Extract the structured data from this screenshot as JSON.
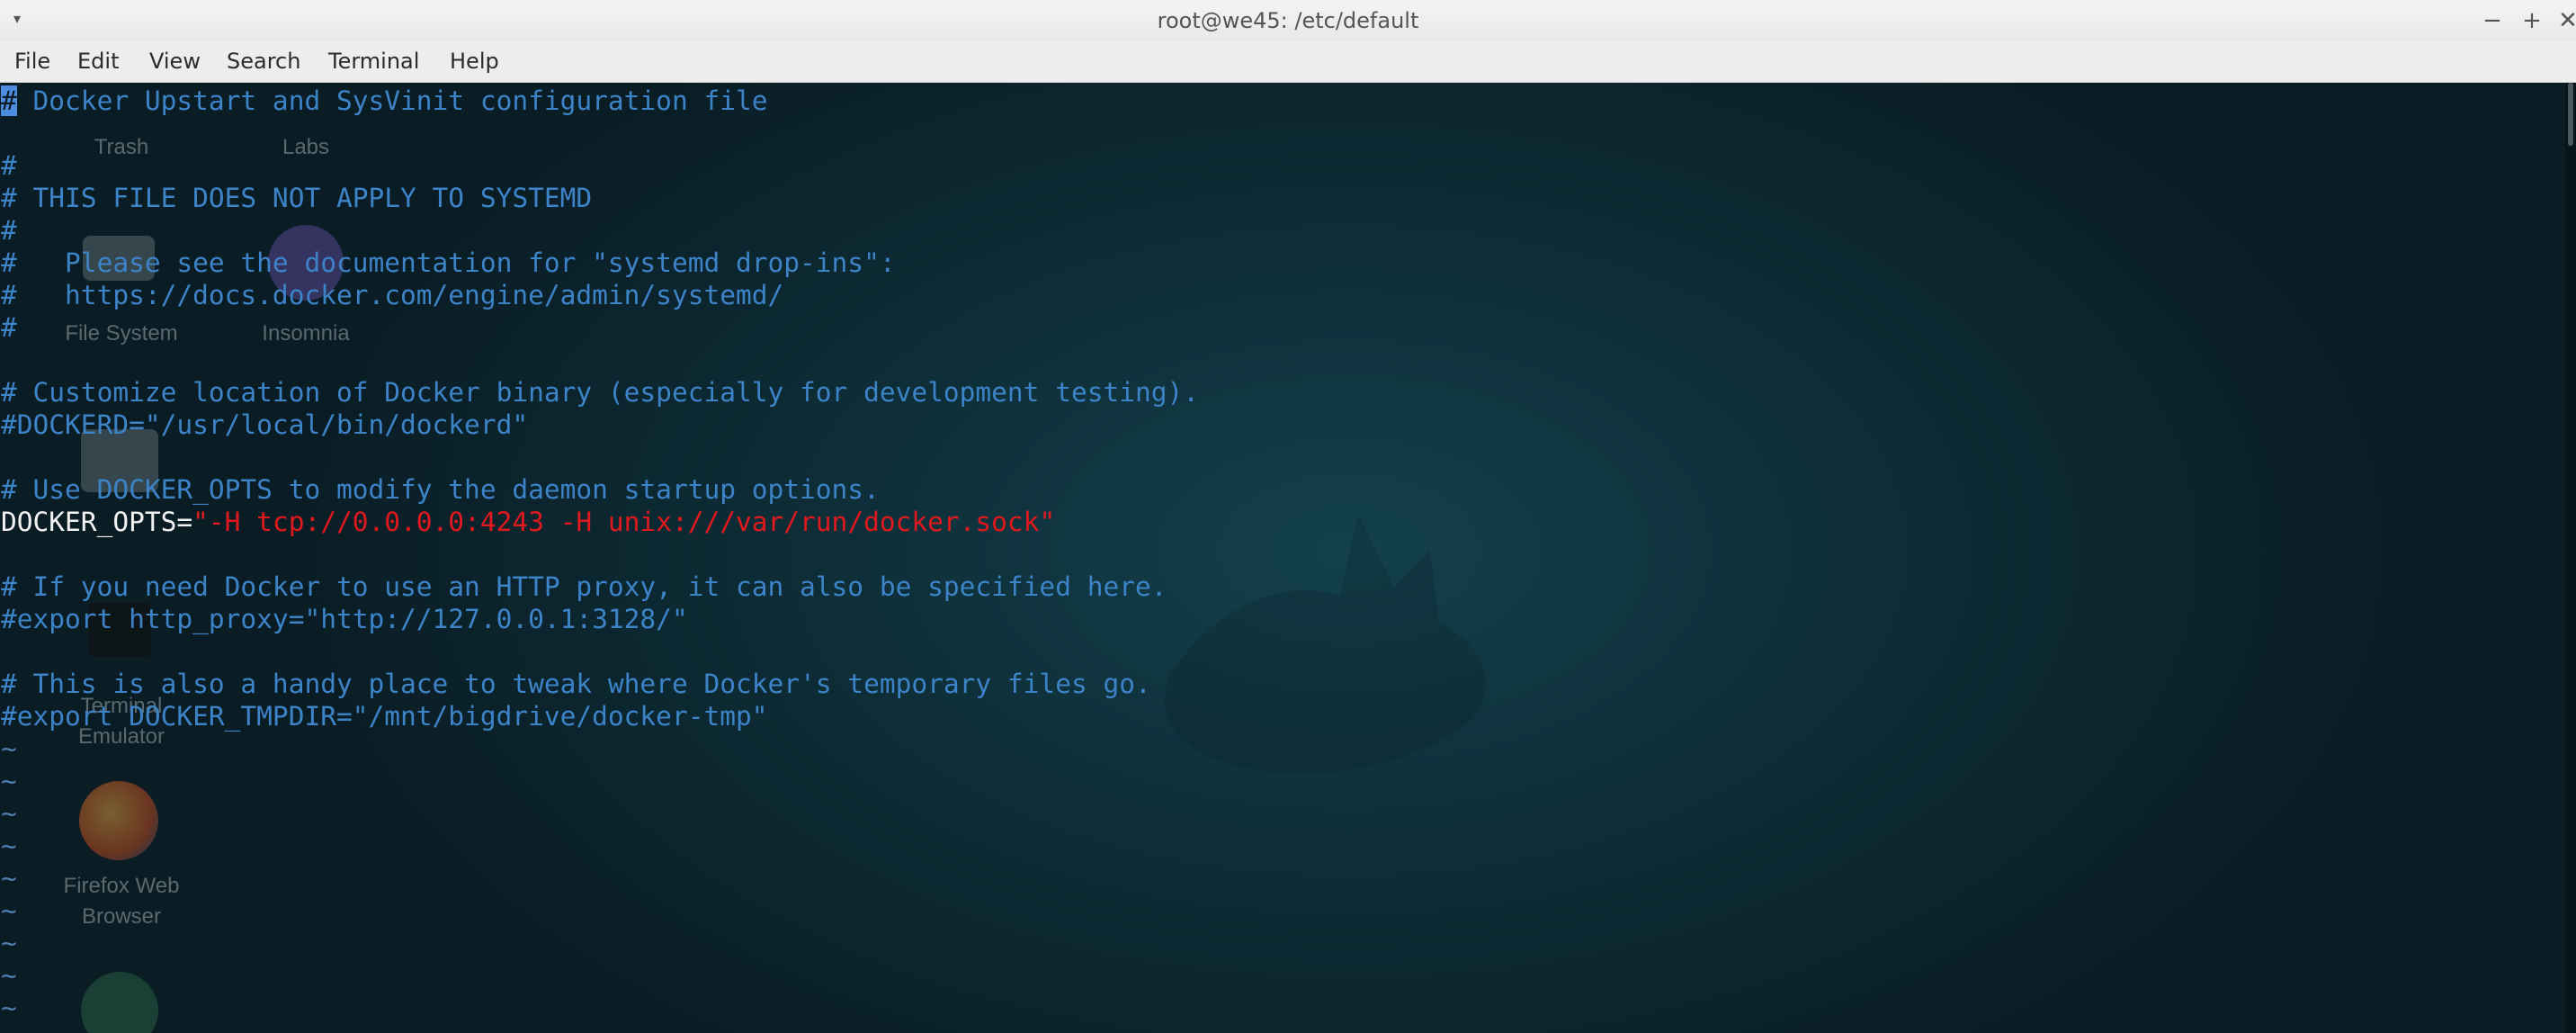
{
  "window": {
    "title": "root@we45: /etc/default",
    "controls": {
      "menu_icon": "▾",
      "minimize": "−",
      "maximize": "+",
      "close": "✕"
    }
  },
  "menubar": {
    "items": [
      "File",
      "Edit",
      "View",
      "Search",
      "Terminal",
      "Help"
    ]
  },
  "desktop_icons": [
    {
      "label": "Trash",
      "icon": "trash-icon"
    },
    {
      "label": "Labs",
      "icon": "folder-icon"
    },
    {
      "label": "File System",
      "icon": "drive-icon"
    },
    {
      "label": "Insomnia",
      "icon": "insomnia-icon"
    },
    {
      "label": "Terminal",
      "label2": "Emulator",
      "icon": "terminal-icon"
    },
    {
      "label": "Firefox Web",
      "label2": "Browser",
      "icon": "firefox-icon"
    },
    {
      "label": "",
      "icon": "atom-icon"
    }
  ],
  "editor": {
    "cursor_char": "#",
    "lines": [
      {
        "type": "comment-first",
        "rest": " Docker Upstart and SysVinit configuration file"
      },
      {
        "type": "blank",
        "text": ""
      },
      {
        "type": "comment",
        "text": "#"
      },
      {
        "type": "comment",
        "text": "# THIS FILE DOES NOT APPLY TO SYSTEMD"
      },
      {
        "type": "comment",
        "text": "#"
      },
      {
        "type": "comment",
        "text": "#   Please see the documentation for \"systemd drop-ins\":"
      },
      {
        "type": "comment",
        "text": "#   https://docs.docker.com/engine/admin/systemd/"
      },
      {
        "type": "comment",
        "text": "#"
      },
      {
        "type": "blank",
        "text": ""
      },
      {
        "type": "comment",
        "text": "# Customize location of Docker binary (especially for development testing)."
      },
      {
        "type": "comment",
        "text": "#DOCKERD=\"/usr/local/bin/dockerd\""
      },
      {
        "type": "blank",
        "text": ""
      },
      {
        "type": "comment",
        "text": "# Use DOCKER_OPTS to modify the daemon startup options."
      },
      {
        "type": "assign",
        "key": "DOCKER_OPTS=",
        "value": "\"-H tcp://0.0.0.0:4243 -H unix:///var/run/docker.sock\""
      },
      {
        "type": "blank",
        "text": ""
      },
      {
        "type": "comment",
        "text": "# If you need Docker to use an HTTP proxy, it can also be specified here."
      },
      {
        "type": "comment",
        "text": "#export http_proxy=\"http://127.0.0.1:3128/\""
      },
      {
        "type": "blank",
        "text": ""
      },
      {
        "type": "comment",
        "text": "# This is also a handy place to tweak where Docker's temporary files go."
      },
      {
        "type": "comment",
        "text": "#export DOCKER_TMPDIR=\"/mnt/bigdrive/docker-tmp\""
      },
      {
        "type": "tilde",
        "text": "~"
      },
      {
        "type": "tilde",
        "text": "~"
      },
      {
        "type": "tilde",
        "text": "~"
      },
      {
        "type": "tilde",
        "text": "~"
      },
      {
        "type": "tilde",
        "text": "~"
      },
      {
        "type": "tilde",
        "text": "~"
      },
      {
        "type": "tilde",
        "text": "~"
      },
      {
        "type": "tilde",
        "text": "~"
      },
      {
        "type": "tilde",
        "text": "~"
      }
    ]
  },
  "colors": {
    "comment": "#3d83c8",
    "plain": "#f2f2f2",
    "string": "#e0191e",
    "cursor": "#4c8de0",
    "background": "#0b1e26"
  }
}
